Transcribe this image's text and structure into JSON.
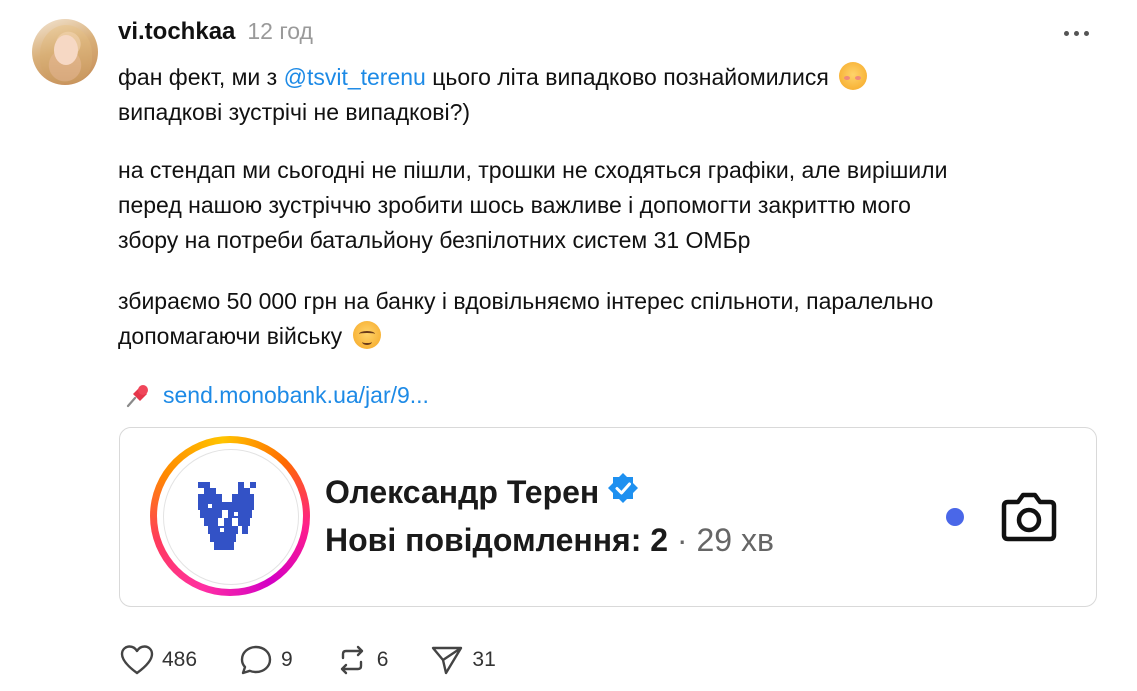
{
  "post": {
    "author": "vi.tochkaa",
    "time": "12 год",
    "paragraph1": {
      "before": "фан фект, ми з ",
      "mention": "@tsvit_terenu",
      "after": " цього літа випадково познайомилися",
      "line2": "випадкові зустрічі не випадкові?)",
      "emoji": "shy-face-emoji"
    },
    "paragraph2": {
      "line1": "на стендап ми сьогодні не пішли, трошки не сходяться графіки, але вирішили",
      "line2": "перед нашою зустріччю зробити шось важливе і допомогти закриттю мого",
      "line3": "збору на потреби батальйону безпілотних систем 31 ОМБр"
    },
    "paragraph3": {
      "line1": "збираємо 50 000 грн на банку і вдовільняємо інтерес спільноти, паралельно",
      "line2": "допомагаючи війську",
      "emoji": "relieved-face-emoji"
    },
    "link": {
      "icon": "pushpin-icon",
      "text": "send.monobank.ua/jar/9..."
    }
  },
  "card": {
    "name": "Олександр Терен",
    "verified_icon": "verified-badge-icon",
    "message_label": "Нові повідомлення: 2",
    "separator": "·",
    "elapsed": "29 хв",
    "unread_dot_color": "#4a67e8"
  },
  "actions": {
    "likes": "486",
    "replies": "9",
    "reposts": "6",
    "shares": "31"
  }
}
